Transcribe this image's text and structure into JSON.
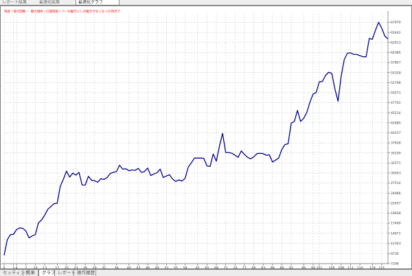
{
  "window": {
    "top_tabs": [
      "レポート結果",
      "最適化結果",
      "最適化グラフ"
    ],
    "bottom_tabs": [
      "セッティング",
      "結果",
      "グラフ",
      "レポート",
      "操作履歴"
    ],
    "active_bottom_tab": 2
  },
  "colors": {
    "line": "#00008b",
    "grid": "#c8c8c8",
    "annotation": "#ff0000",
    "axis_text": "#333333"
  },
  "chart_data": {
    "type": "line",
    "annotation": "残高 / 取引回数 ・ 最大損失 / 口座残高 / バーの動きにしの動きがなくなった時点で",
    "xlabel": "",
    "ylabel": "",
    "grid": true,
    "xlim": [
      0,
      123
    ],
    "ylim": [
      7206,
      70140
    ],
    "x_ticks": [
      0,
      3,
      4,
      7,
      10,
      13,
      17,
      20,
      23,
      26,
      29,
      32,
      36,
      40,
      43,
      46,
      49,
      52,
      55,
      58,
      62,
      65,
      68,
      71,
      74,
      77,
      80,
      83,
      86,
      89,
      92,
      96,
      99,
      101,
      105,
      108,
      111,
      114,
      118,
      121
    ],
    "y_ticks": [
      7206,
      9735,
      12343,
      14871,
      17400,
      19928,
      22457,
      24986,
      27514,
      30043,
      32571,
      35100,
      37628,
      40157,
      42685,
      45214,
      47742,
      50271,
      52799,
      55328,
      57857,
      60385,
      62913,
      65442,
      67970
    ],
    "x": [
      0,
      1,
      2,
      3,
      4,
      5,
      6,
      7,
      8,
      9,
      10,
      11,
      12,
      13,
      14,
      15,
      16,
      17,
      18,
      19,
      20,
      21,
      22,
      23,
      24,
      25,
      26,
      27,
      28,
      29,
      30,
      31,
      32,
      33,
      34,
      35,
      36,
      37,
      38,
      39,
      40,
      41,
      42,
      43,
      44,
      45,
      46,
      47,
      48,
      49,
      50,
      51,
      52,
      53,
      54,
      55,
      56,
      57,
      58,
      59,
      60,
      61,
      62,
      63,
      64,
      65,
      66,
      67,
      68,
      69,
      70,
      71,
      72,
      73,
      74,
      75,
      76,
      77,
      78,
      79,
      80,
      81,
      82,
      83,
      84,
      85,
      86,
      87,
      88,
      89,
      90,
      91,
      92,
      93,
      94,
      95,
      96,
      97,
      98,
      99,
      100,
      101,
      102,
      103,
      104,
      105,
      106,
      107,
      108,
      109,
      110,
      111,
      112,
      113,
      114,
      115,
      116,
      117,
      118,
      119,
      120,
      121,
      122,
      123
    ],
    "y": [
      9300,
      13200,
      14500,
      14600,
      15800,
      16200,
      16100,
      15400,
      13700,
      14200,
      14500,
      17500,
      18200,
      19400,
      20900,
      21600,
      22300,
      22400,
      26700,
      28500,
      30500,
      29000,
      30000,
      29500,
      30200,
      27000,
      27000,
      29200,
      28200,
      28100,
      27700,
      28600,
      28400,
      28900,
      29900,
      30200,
      30400,
      32000,
      31000,
      31100,
      30600,
      30800,
      30700,
      31200,
      30200,
      30400,
      31300,
      29400,
      29800,
      30100,
      31000,
      28900,
      29300,
      29600,
      28500,
      27900,
      28300,
      28000,
      28700,
      31500,
      32600,
      33800,
      33800,
      33800,
      33700,
      31800,
      31700,
      34800,
      33000,
      36800,
      40000,
      35200,
      35200,
      35000,
      34500,
      34000,
      35600,
      34700,
      34000,
      33600,
      34100,
      34900,
      35000,
      34900,
      34500,
      34600,
      32800,
      33300,
      33800,
      36000,
      37200,
      37400,
      42600,
      43000,
      45800,
      43000,
      43800,
      45300,
      47900,
      49900,
      50300,
      53000,
      53100,
      54600,
      55400,
      55100,
      51200,
      48100,
      54400,
      58600,
      60200,
      60300,
      59900,
      59900,
      59600,
      59300,
      59300,
      63900,
      63700,
      66000,
      68000,
      66500,
      64500,
      63800
    ]
  }
}
